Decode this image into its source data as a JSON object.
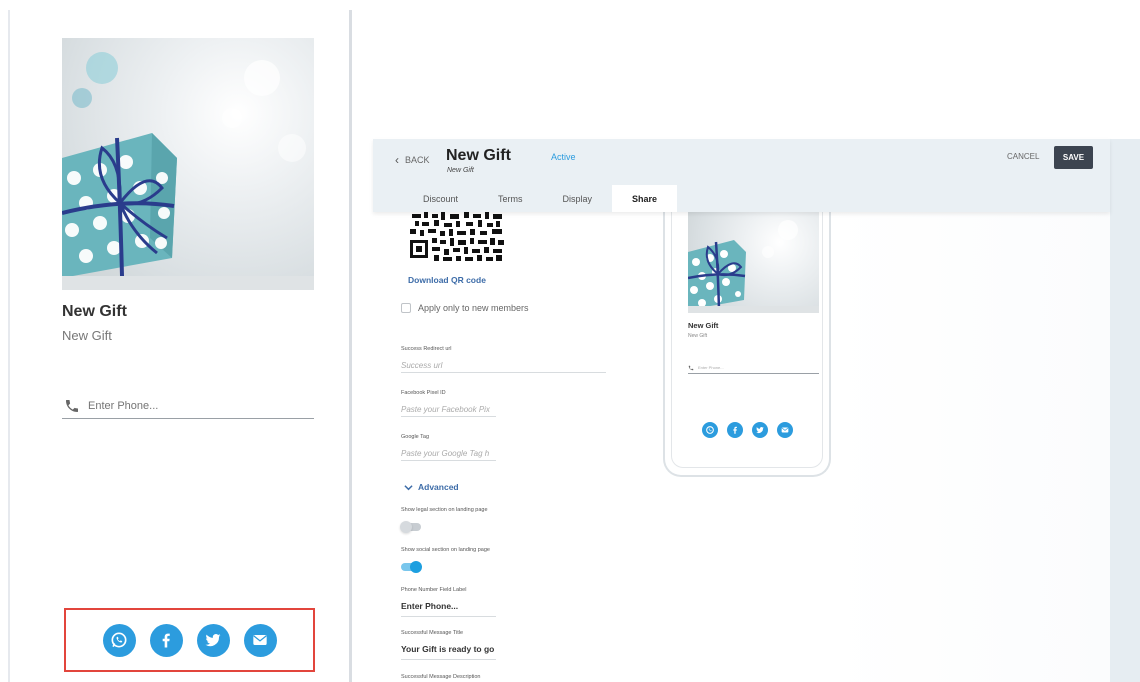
{
  "left_preview": {
    "title": "New Gift",
    "subtitle": "New Gift",
    "phone_placeholder": "Enter Phone...",
    "social_icons": [
      "whatsapp-icon",
      "facebook-icon",
      "twitter-icon",
      "email-icon"
    ],
    "highlight_color": "#e2453c",
    "social_color": "#2c9cde"
  },
  "editor": {
    "back_label": "BACK",
    "title": "New Gift",
    "subtitle": "New Gift",
    "status": "Active",
    "cancel_label": "CANCEL",
    "save_label": "SAVE",
    "tabs": [
      {
        "label": "Discount",
        "active": false
      },
      {
        "label": "Terms",
        "active": false
      },
      {
        "label": "Display",
        "active": false
      },
      {
        "label": "Share",
        "active": true
      }
    ],
    "download_qr_label": "Download QR code",
    "apply_new_members_label": "Apply only to new members",
    "fields": {
      "success_redirect": {
        "label": "Success Redirect url",
        "placeholder": "Success url"
      },
      "facebook_pixel": {
        "label": "Facebook Pixel ID",
        "placeholder": "Paste your Facebook Pix"
      },
      "google_tag": {
        "label": "Google Tag",
        "placeholder": "Paste your Google Tag h"
      }
    },
    "advanced_label": "Advanced",
    "show_legal_label": "Show legal section on landing page",
    "show_legal_on": false,
    "show_social_label": "Show social section on landing page",
    "show_social_on": true,
    "phone_label_title": "Phone Number Field Label",
    "phone_label_value": "Enter Phone...",
    "success_title_label": "Successful Message Title",
    "success_title_value": "Your Gift is ready to go",
    "success_desc_label": "Successful Message Description"
  },
  "phone_preview": {
    "title": "New Gift",
    "subtitle": "New Gift",
    "phone_placeholder": "Enter Phone..."
  }
}
